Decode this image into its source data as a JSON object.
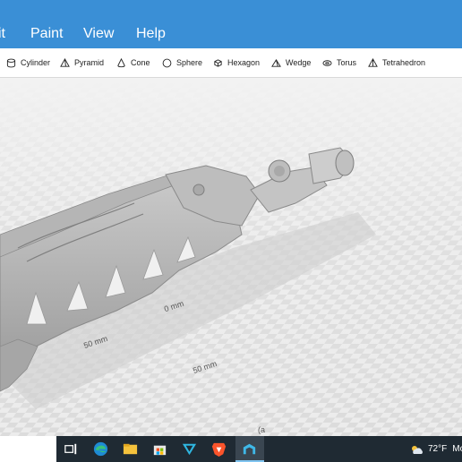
{
  "menu": {
    "items": [
      {
        "label": "it"
      },
      {
        "label": "Paint"
      },
      {
        "label": "View"
      },
      {
        "label": "Help"
      }
    ]
  },
  "toolbar": {
    "shapes": [
      {
        "label": "Cylinder",
        "icon": "cylinder-icon"
      },
      {
        "label": "Pyramid",
        "icon": "pyramid-icon"
      },
      {
        "label": "Cone",
        "icon": "cone-icon"
      },
      {
        "label": "Sphere",
        "icon": "sphere-icon"
      },
      {
        "label": "Hexagon",
        "icon": "hexagon-icon"
      },
      {
        "label": "Wedge",
        "icon": "wedge-icon"
      },
      {
        "label": "Torus",
        "icon": "torus-icon"
      },
      {
        "label": "Tetrahedron",
        "icon": "tetrahedron-icon"
      }
    ]
  },
  "viewport": {
    "labels": {
      "zero": "0 mm",
      "fifty_a": "50 mm",
      "fifty_b": "50 mm",
      "bottom": "(a"
    }
  },
  "taskbar": {
    "weather_temp": "72°F",
    "weather_text": "Mo",
    "apps": [
      "task-view-icon",
      "edge-icon",
      "file-explorer-icon",
      "store-icon",
      "vpn-icon",
      "brave-icon",
      "paint-3d-icon"
    ]
  },
  "colors": {
    "menubar": "#3a8fd6",
    "taskbar": "#1f2a33"
  }
}
